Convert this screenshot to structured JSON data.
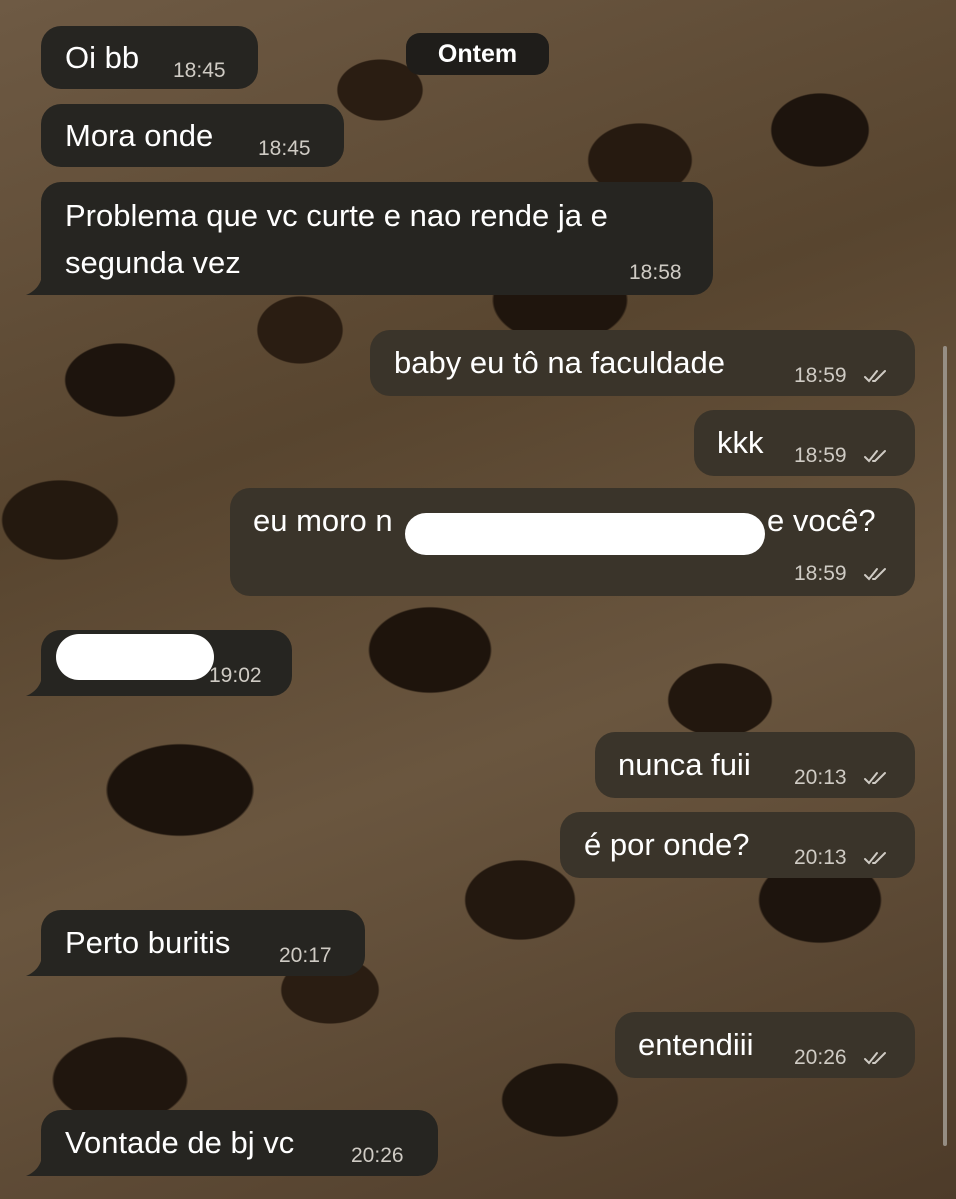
{
  "date_separator": "Ontem",
  "messages": [
    {
      "text": "Oi bb",
      "time": "18:45"
    },
    {
      "text": "Mora onde",
      "time": "18:45"
    },
    {
      "text_line1": "Problema que vc curte e nao rende ja e",
      "text_line2": "segunda vez",
      "time": "18:58"
    },
    {
      "text": "baby eu tô na faculdade",
      "time": "18:59"
    },
    {
      "text": "kkk",
      "time": "18:59"
    },
    {
      "text_start": "eu moro n",
      "text_end": "e você?",
      "time": "18:59"
    },
    {
      "time": "19:02"
    },
    {
      "text": "nunca fuii",
      "time": "20:13"
    },
    {
      "text": "é por onde?",
      "time": "20:13"
    },
    {
      "text": "Perto buritis",
      "time": "20:17"
    },
    {
      "text": "entendiii",
      "time": "20:26"
    },
    {
      "text": "Vontade de bj vc",
      "time": "20:26"
    }
  ],
  "colors": {
    "incoming_bubble": "#262521",
    "outgoing_bubble": "#3a342a",
    "text": "#ffffff",
    "timestamp": "#cfcbc4"
  },
  "icons": {
    "read_receipt": "double-check-icon"
  }
}
